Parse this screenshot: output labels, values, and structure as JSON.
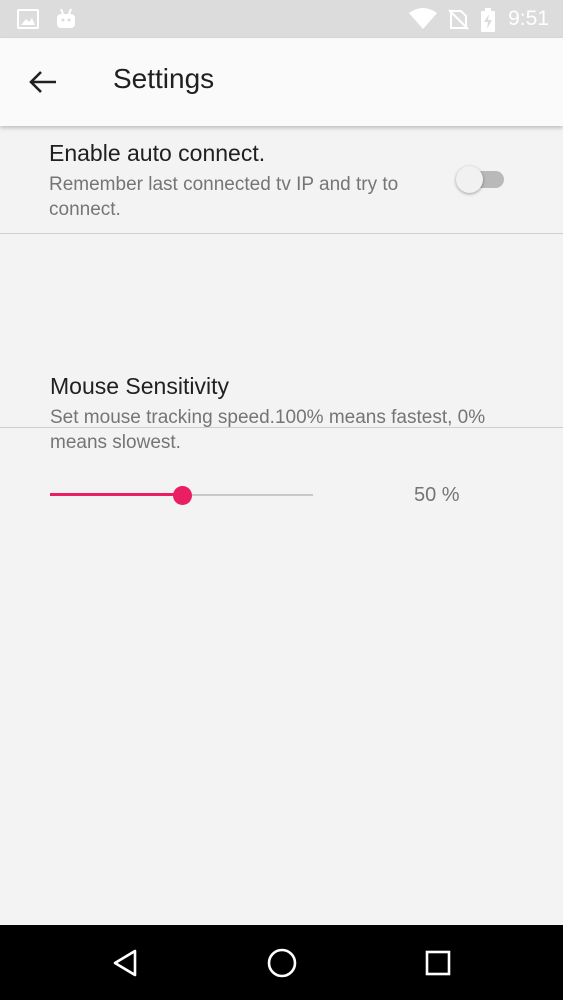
{
  "status_bar": {
    "time": "9:51",
    "icons": [
      "image-icon",
      "android-icon",
      "wifi-icon",
      "no-sim-icon",
      "battery-charging-icon"
    ]
  },
  "app_bar": {
    "back_icon": "arrow-left-icon",
    "title": "Settings"
  },
  "preferences": {
    "auto_connect": {
      "title": "Enable auto connect.",
      "summary": "Remember last connected tv IP and try to connect.",
      "enabled": false
    },
    "mouse_sensitivity": {
      "title": "Mouse Sensitivity",
      "summary": "Set mouse tracking speed.100% means fastest, 0% means slowest.",
      "value_percent": 50,
      "value_label": "50 %"
    }
  },
  "nav_bar": {
    "buttons": [
      "back-triangle-icon",
      "home-circle-icon",
      "recents-square-icon"
    ]
  },
  "colors": {
    "accent": "#e91e63",
    "background": "#f4f3f4",
    "app_bar": "#fafafa",
    "status_bar": "#dcdcdc"
  }
}
